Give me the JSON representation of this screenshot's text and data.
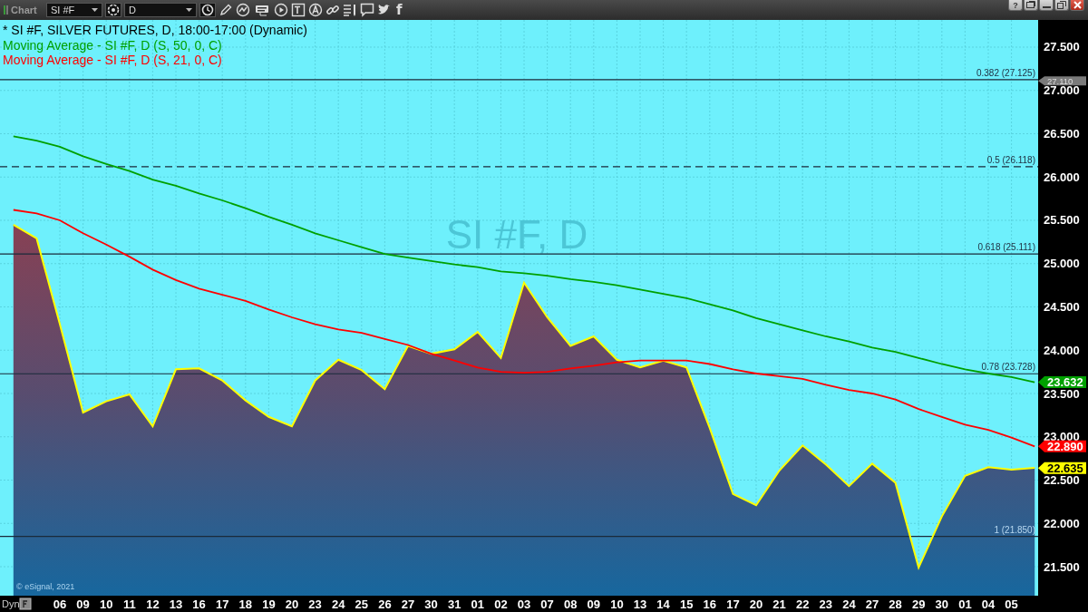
{
  "window": {
    "title": "Chart",
    "help": "?"
  },
  "toolbar": {
    "symbol": "SI #F",
    "interval": "D",
    "share_letter": "f"
  },
  "chart": {
    "watermark": "SI #F, D",
    "copyright": "© eSignal, 2021",
    "mode": "Dyn",
    "last_value_tags": [
      "23.632",
      "22.890",
      "22.635"
    ],
    "chart_data": {
      "type": "line",
      "grid": true,
      "categories": [
        null,
        null,
        "06",
        "09",
        "10",
        "11",
        "12",
        "13",
        "16",
        "17",
        "18",
        "19",
        "20",
        "23",
        "24",
        "25",
        "26",
        "27",
        "30",
        "31",
        "01",
        "02",
        "03",
        "07",
        "08",
        "09",
        "10",
        "13",
        "14",
        "15",
        "16",
        "17",
        "20",
        "21",
        "22",
        "23",
        "24",
        "27",
        "28",
        "29",
        "30",
        "01",
        "04",
        "05",
        null
      ],
      "ylim": [
        21.165,
        27.814
      ],
      "yticks": [
        {
          "value": 21.5,
          "label": "21.500"
        },
        {
          "value": 22,
          "label": "22.000"
        },
        {
          "value": 22.5,
          "label": "22.500"
        },
        {
          "value": 23,
          "label": "23.000"
        },
        {
          "value": 23.5,
          "label": "23.500"
        },
        {
          "value": 24,
          "label": "24.000"
        },
        {
          "value": 24.5,
          "label": "24.500"
        },
        {
          "value": 25,
          "label": "25.000"
        },
        {
          "value": 25.5,
          "label": "25.500"
        },
        {
          "value": 26,
          "label": "26.000"
        },
        {
          "value": 26.5,
          "label": "26.500"
        },
        {
          "value": 27,
          "label": "27.000"
        },
        {
          "value": 27.5,
          "label": "27.500"
        }
      ],
      "series": [
        {
          "name": "* SI #F, SILVER FUTURES, D, 18:00-17:00 (Dynamic)",
          "color": "#ffff00",
          "values": [
            25.45,
            25.29,
            24.3,
            23.28,
            23.41,
            23.49,
            23.12,
            23.78,
            23.79,
            23.65,
            23.42,
            23.23,
            23.12,
            23.65,
            23.89,
            23.77,
            23.55,
            24.05,
            23.96,
            24.01,
            24.21,
            23.91,
            24.78,
            24.38,
            24.05,
            24.16,
            23.89,
            23.8,
            23.88,
            23.8,
            23.1,
            22.34,
            22.21,
            22.61,
            22.9,
            22.68,
            22.43,
            22.69,
            22.47,
            21.49,
            22.08,
            22.55,
            22.65,
            22.62,
            22.64
          ]
        },
        {
          "name": "Moving Average - SI #F, D (S, 50, 0, C)",
          "color": "#00a000",
          "values": [
            26.47,
            26.42,
            26.35,
            26.24,
            26.15,
            26.07,
            25.97,
            25.9,
            25.81,
            25.73,
            25.64,
            25.54,
            25.45,
            25.35,
            25.27,
            25.19,
            25.11,
            25.07,
            25.03,
            24.99,
            24.96,
            24.91,
            24.89,
            24.86,
            24.82,
            24.79,
            24.75,
            24.7,
            24.65,
            24.6,
            24.53,
            24.46,
            24.37,
            24.3,
            24.23,
            24.16,
            24.1,
            24.03,
            23.98,
            23.91,
            23.84,
            23.78,
            23.73,
            23.69,
            23.63
          ]
        },
        {
          "name": "Moving Average - SI #F, D (S, 21, 0, C)",
          "color": "#ff0000",
          "values": [
            25.62,
            25.58,
            25.5,
            25.35,
            25.22,
            25.08,
            24.93,
            24.81,
            24.71,
            24.64,
            24.57,
            24.47,
            24.38,
            24.3,
            24.24,
            24.2,
            24.13,
            24.06,
            23.96,
            23.88,
            23.8,
            23.75,
            23.74,
            23.75,
            23.79,
            23.82,
            23.86,
            23.88,
            23.88,
            23.88,
            23.84,
            23.78,
            23.73,
            23.7,
            23.67,
            23.6,
            23.54,
            23.5,
            23.43,
            23.32,
            23.23,
            23.14,
            23.08,
            22.99,
            22.89
          ]
        }
      ],
      "ref_lines": [
        {
          "axis": "y",
          "value": 27.125,
          "label": "0.382 (27.125)"
        },
        {
          "axis": "y",
          "value": 26.118,
          "label": "0.5 (26.118)"
        },
        {
          "axis": "y",
          "value": 25.111,
          "label": "0.618 (25.111)"
        },
        {
          "axis": "y",
          "value": 23.728,
          "label": "0.78 (23.728)"
        },
        {
          "axis": "y",
          "value": 21.85,
          "label": "1 (21.850)"
        }
      ],
      "annotations": [
        "27.110"
      ]
    }
  }
}
